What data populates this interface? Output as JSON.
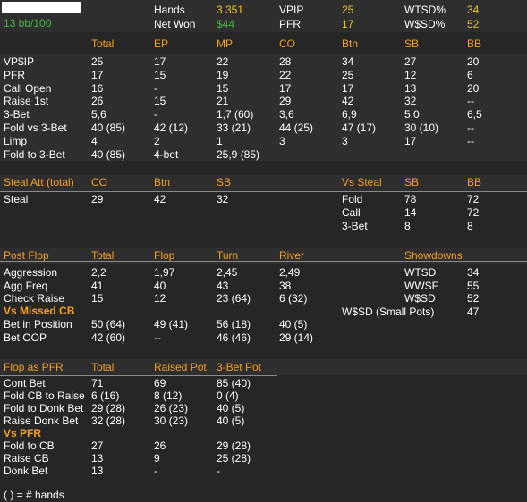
{
  "header": {
    "stakes": "13 bb/100",
    "labels": {
      "hands": "Hands",
      "net_won": "Net Won",
      "vpip": "VPIP",
      "pfr": "PFR",
      "wtsd": "WTSD%",
      "wsd": "W$SD%"
    },
    "values": {
      "hands": "3 351",
      "net_won": "$44",
      "vpip": "25",
      "pfr": "17",
      "wtsd": "34",
      "wsd": "52"
    }
  },
  "preflop": {
    "columns": [
      "Total",
      "EP",
      "MP",
      "CO",
      "Btn",
      "SB",
      "BB"
    ],
    "rows": [
      {
        "label": "VP$IP",
        "values": [
          "25",
          "17",
          "22",
          "28",
          "34",
          "27",
          "20"
        ]
      },
      {
        "label": "PFR",
        "values": [
          "17",
          "15",
          "19",
          "22",
          "25",
          "12",
          "6"
        ]
      },
      {
        "label": "Call Open",
        "values": [
          "16",
          "-",
          "15",
          "17",
          "17",
          "13",
          "20"
        ]
      },
      {
        "label": "Raise 1st",
        "values": [
          "26",
          "15",
          "21",
          "29",
          "42",
          "32",
          "--"
        ]
      },
      {
        "label": "3-Bet",
        "values": [
          "5,6",
          "-",
          "1,7 (60)",
          "3,6",
          "6,9",
          "5,0",
          "6,5"
        ]
      },
      {
        "label": "Fold vs 3-Bet",
        "values": [
          "40 (85)",
          "42 (12)",
          "33 (21)",
          "44 (25)",
          "47 (17)",
          "30 (10)",
          "--"
        ]
      },
      {
        "label": "Limp",
        "values": [
          "4",
          "2",
          "1",
          "3",
          "3",
          "17",
          "--"
        ]
      },
      {
        "label": "Fold to 3-Bet",
        "values": [
          "40 (85)",
          "4-bet",
          "25,9 (85)",
          "",
          "",
          "",
          ""
        ]
      }
    ]
  },
  "steal": {
    "title": "Steal Att (total)",
    "columns": [
      "CO",
      "Btn",
      "SB"
    ],
    "rows": [
      {
        "label": "Steal",
        "values": [
          "29",
          "42",
          "32"
        ]
      }
    ]
  },
  "vs_steal": {
    "title": "Vs Steal",
    "columns": [
      "SB",
      "BB"
    ],
    "rows": [
      {
        "label": "Fold",
        "values": [
          "78",
          "72"
        ]
      },
      {
        "label": "Call",
        "values": [
          "14",
          "72"
        ]
      },
      {
        "label": "3-Bet",
        "values": [
          "8",
          "8"
        ]
      }
    ]
  },
  "postflop": {
    "title": "Post Flop",
    "columns": [
      "Total",
      "Flop",
      "Turn",
      "River"
    ],
    "rows": [
      {
        "label": "Aggression",
        "values": [
          "2,2",
          "1,97",
          "2,45",
          "2,49"
        ]
      },
      {
        "label": "Agg Freq",
        "values": [
          "41",
          "40",
          "43",
          "38"
        ]
      },
      {
        "label": "Check Raise",
        "values": [
          "15",
          "12",
          "23 (64)",
          "6 (32)"
        ]
      }
    ],
    "subheading": "Vs Missed CB",
    "sub_rows": [
      {
        "label": "Bet in Position",
        "values": [
          "50 (64)",
          "49 (41)",
          "56 (18)",
          "40 (5)"
        ]
      },
      {
        "label": "Bet OOP",
        "values": [
          "42 (60)",
          "--",
          "46 (46)",
          "29 (14)"
        ]
      }
    ]
  },
  "showdowns": {
    "title": "Showdowns",
    "rows": [
      {
        "label": "WTSD",
        "value": "34"
      },
      {
        "label": "WWSF",
        "value": "55"
      },
      {
        "label": "W$SD",
        "value": "52"
      },
      {
        "label": "W$SD (Small Pots)",
        "value": "47"
      }
    ]
  },
  "flop_pfr": {
    "title": "Flop as PFR",
    "columns": [
      "Total",
      "Raised Pot",
      "3-Bet Pot"
    ],
    "rows": [
      {
        "label": "Cont Bet",
        "values": [
          "71",
          "69",
          "85 (40)"
        ]
      },
      {
        "label": "Fold CB to Raise",
        "values": [
          "6 (16)",
          "8 (12)",
          "0 (4)"
        ]
      },
      {
        "label": "Fold to Donk Bet",
        "values": [
          "29 (28)",
          "26 (23)",
          "40 (5)"
        ]
      },
      {
        "label": "Raise Donk Bet",
        "values": [
          "32 (28)",
          "30 (23)",
          "40 (5)"
        ]
      }
    ],
    "subheading": "Vs PFR",
    "sub_rows": [
      {
        "label": "Fold to CB",
        "values": [
          "27",
          "26",
          "29 (28)"
        ]
      },
      {
        "label": "Raise CB",
        "values": [
          "13",
          "9",
          "25 (28)"
        ]
      },
      {
        "label": "Donk Bet",
        "values": [
          "13",
          "-",
          "-"
        ]
      }
    ]
  },
  "footer": "( ) = # hands",
  "colors": {
    "background": "#262626",
    "stripe": "#2e2e2e",
    "heading": "#f5a020",
    "value": "#f0c419",
    "positive": "#48b548",
    "text": "#ffffff"
  }
}
